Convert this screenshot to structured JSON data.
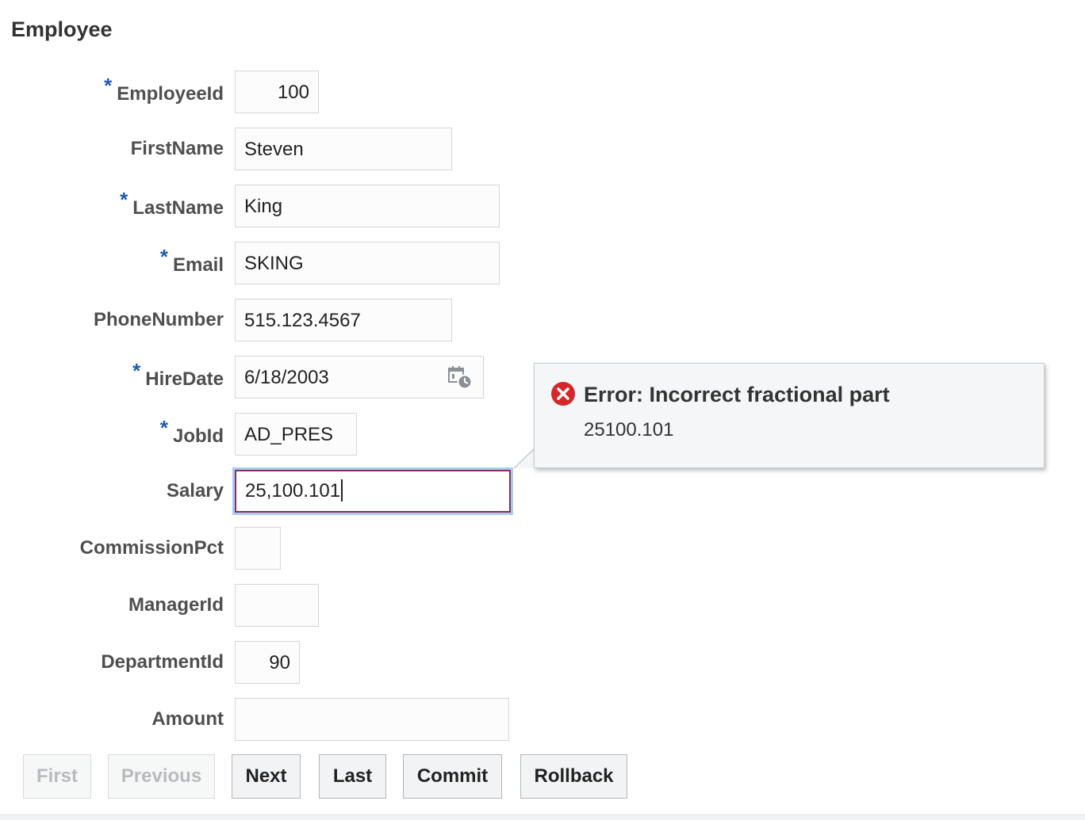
{
  "page": {
    "title": "Employee"
  },
  "fields": [
    {
      "id": "employee-id",
      "label": "EmployeeId",
      "required": true,
      "value": "100"
    },
    {
      "id": "first-name",
      "label": "FirstName",
      "required": false,
      "value": "Steven"
    },
    {
      "id": "last-name",
      "label": "LastName",
      "required": true,
      "value": "King"
    },
    {
      "id": "email",
      "label": "Email",
      "required": true,
      "value": "SKING"
    },
    {
      "id": "phone-number",
      "label": "PhoneNumber",
      "required": false,
      "value": "515.123.4567"
    },
    {
      "id": "hire-date",
      "label": "HireDate",
      "required": true,
      "value": "6/18/2003"
    },
    {
      "id": "job-id",
      "label": "JobId",
      "required": true,
      "value": "AD_PRES"
    },
    {
      "id": "salary",
      "label": "Salary",
      "required": false,
      "value": "25,100.101"
    },
    {
      "id": "commission-pct",
      "label": "CommissionPct",
      "required": false,
      "value": ""
    },
    {
      "id": "manager-id",
      "label": "ManagerId",
      "required": false,
      "value": ""
    },
    {
      "id": "department-id",
      "label": "DepartmentId",
      "required": false,
      "value": "90"
    },
    {
      "id": "amount",
      "label": "Amount",
      "required": false,
      "value": ""
    }
  ],
  "required_marker": "*",
  "error": {
    "title": "Error: Incorrect fractional part",
    "detail": "25100.101"
  },
  "buttons": {
    "first": "First",
    "previous": "Previous",
    "next": "Next",
    "last": "Last",
    "commit": "Commit",
    "rollback": "Rollback"
  },
  "icons": {
    "calendar": "calendar-clock-icon",
    "error": "error-x-icon"
  },
  "colors": {
    "required_marker": "#1f5cb8",
    "error_icon": "#d7262b",
    "salary_border": "#8a2f55",
    "focus_ring": "#a9ccf2"
  }
}
